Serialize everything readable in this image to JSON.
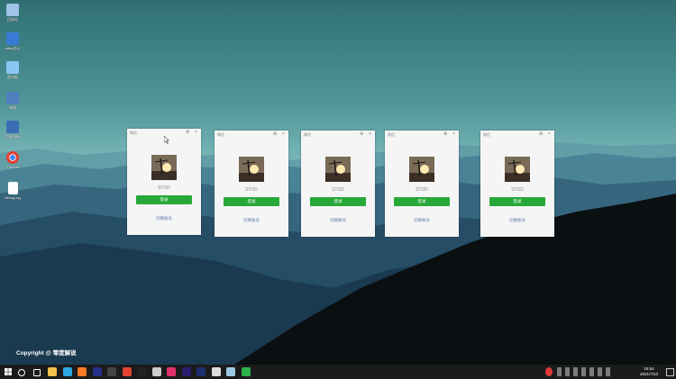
{
  "desktop": {
    "icons": [
      {
        "label": "回收站",
        "icon": "recycle-bin-icon",
        "color": "#9fc3e6"
      },
      {
        "label": "office办公",
        "icon": "office-icon",
        "color": "#3a7bd5"
      },
      {
        "label": "此电脑",
        "icon": "computer-icon",
        "color": "#8cc6f2"
      },
      {
        "label": "网络",
        "icon": "network-icon",
        "color": "#4f7fbf"
      },
      {
        "label": "控制面板",
        "icon": "control-panel-icon",
        "color": "#3b6db5"
      },
      {
        "label": "Chrome",
        "icon": "chrome-icon",
        "color": "#e34133"
      },
      {
        "label": "debug.log",
        "icon": "file-icon",
        "color": "#ffffff"
      }
    ],
    "copyright": "Copyright @ 零度解说"
  },
  "wechat_windows": [
    {
      "title": "微信",
      "name": "STOD",
      "login_label": "登录",
      "switch_label": "切换账号"
    },
    {
      "title": "微信",
      "name": "STOD",
      "login_label": "登录",
      "switch_label": "切换账号"
    },
    {
      "title": "微信",
      "name": "STOD",
      "login_label": "登录",
      "switch_label": "切换账号"
    },
    {
      "title": "微信",
      "name": "STOD",
      "login_label": "登录",
      "switch_label": "切换账号"
    },
    {
      "title": "微信",
      "name": "STOD",
      "login_label": "登录",
      "switch_label": "切换账号"
    }
  ],
  "window_buttons": {
    "settings": "⚙",
    "close": "×"
  },
  "taskbar": {
    "apps": [
      {
        "icon": "search-icon",
        "color": "#ffffff"
      },
      {
        "icon": "task-view-icon",
        "color": "#ffffff"
      },
      {
        "icon": "file-explorer-icon",
        "color": "#f3c24b"
      },
      {
        "icon": "edge-icon",
        "color": "#2fa7e0"
      },
      {
        "icon": "firefox-icon",
        "color": "#ff7a24"
      },
      {
        "icon": "photoshop-icon",
        "color": "#26308a"
      },
      {
        "icon": "pen-app-icon",
        "color": "#444444"
      },
      {
        "icon": "chrome-icon",
        "color": "#e34133"
      },
      {
        "icon": "terminal-icon",
        "color": "#222222"
      },
      {
        "icon": "media-icon",
        "color": "#cccccc"
      },
      {
        "icon": "pink-app-icon",
        "color": "#e0336d"
      },
      {
        "icon": "premiere-icon",
        "color": "#2a1f6e"
      },
      {
        "icon": "after-effects-icon",
        "color": "#1e2f6e"
      },
      {
        "icon": "clock-app-icon",
        "color": "#dddddd"
      },
      {
        "icon": "notepad-icon",
        "color": "#9ec9e6"
      },
      {
        "icon": "wechat-icon",
        "color": "#2bb24c"
      }
    ],
    "clock_time": "15:54",
    "clock_date": "2021/7/13"
  }
}
